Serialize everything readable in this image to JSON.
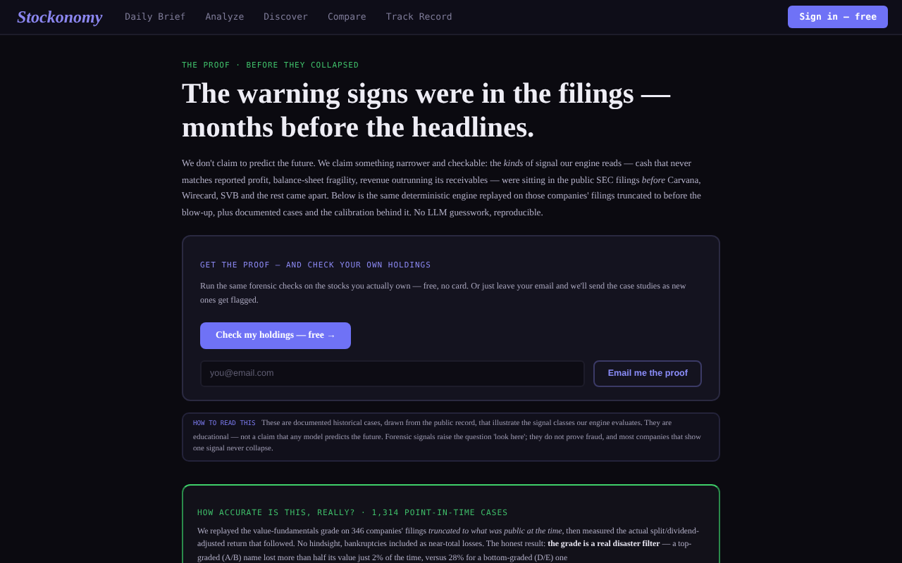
{
  "nav": {
    "logo": "Stockonomy",
    "links": [
      "Daily Brief",
      "Analyze",
      "Discover",
      "Compare",
      "Track Record"
    ],
    "cta": "Sign in — free"
  },
  "hero": {
    "eyebrow": "THE PROOF · BEFORE THEY COLLAPSED",
    "title": "The warning signs were in the filings — months before the headlines.",
    "intro": "We don't claim to predict the future. We claim something narrower and checkable: the *kinds* of signal our engine reads — cash that never matches reported profit, balance-sheet fragility, revenue outrunning its receivables — were sitting in the public SEC filings *before* Carvana, Wirecard, SVB and the rest came apart. Below is the same deterministic engine replayed on those companies' filings truncated to before the blow-up, plus documented cases and the calibration behind it. No LLM guesswork, reproducible."
  },
  "proof_card": {
    "eyebrow": "GET THE PROOF — AND CHECK YOUR OWN HOLDINGS",
    "text": "Run the same forensic checks on the stocks you actually own — free, no card. Or just leave your email and we'll send the case studies as new ones get flagged.",
    "button": "Check my holdings — free →",
    "email": {
      "placeholder": "you@email.com"
    },
    "email_button": "Email me the proof"
  },
  "note": {
    "label": "HOW TO READ THIS",
    "text": "These are documented historical cases, drawn from the public record, that illustrate the signal classes our engine evaluates. They are educational — not a claim that any model predicts the future. Forensic signals raise the question 'look here'; they do not prove fraud, and most companies that show one signal never collapse."
  },
  "accuracy": {
    "eyebrow": "HOW ACCURATE IS THIS, REALLY? · 1,314 POINT-IN-TIME CASES",
    "text": "We replayed the value-fundamentals grade on 346 companies' filings *truncated to what was public at the time*, then measured the actual split/dividend-adjusted return that followed. No hindsight, bankruptcies included as near-total losses. The honest result: **the grade is a real disaster filter** — a top-graded (A/B) name lost more than half its value just 2% of the time, versus 28% for a bottom-graded (D/E) one"
  }
}
